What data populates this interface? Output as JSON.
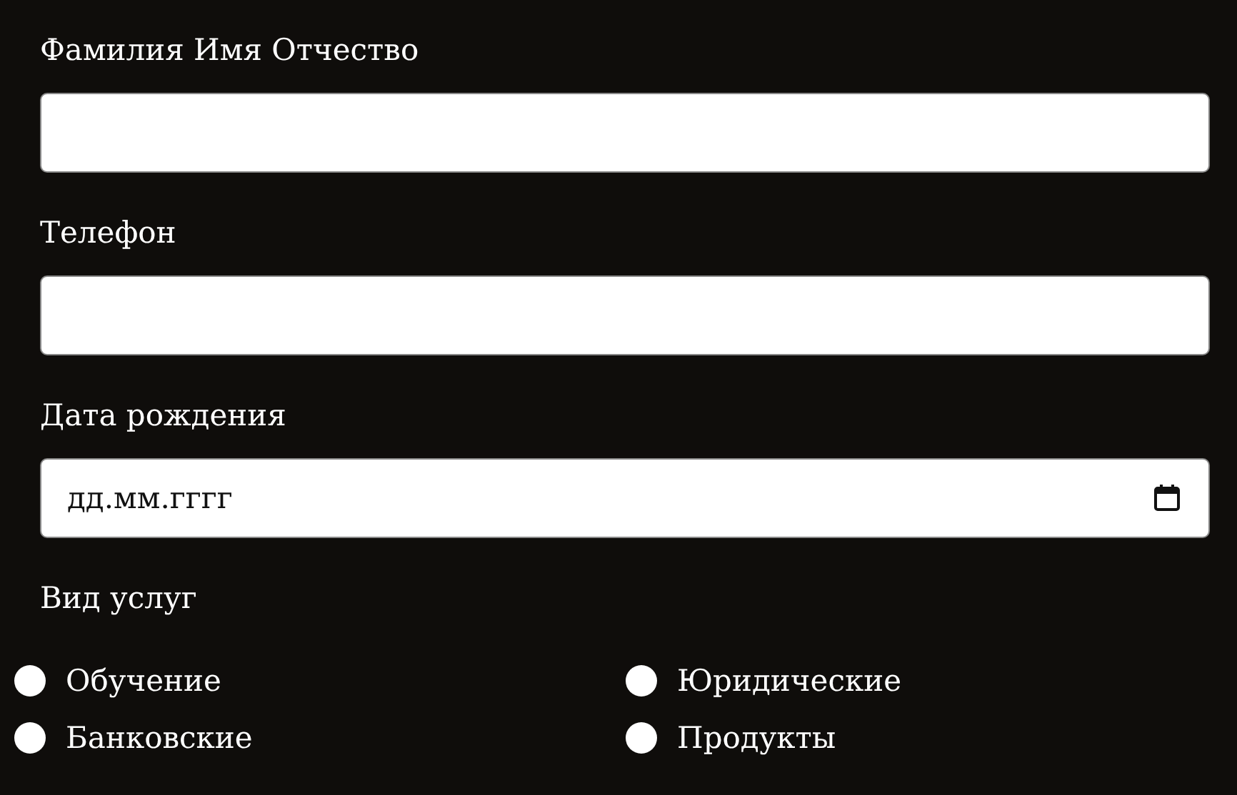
{
  "fields": [
    {
      "kind": "text",
      "label": "Фамилия Имя Отчество"
    },
    {
      "kind": "text",
      "label": "Телефон"
    },
    {
      "kind": "date",
      "label": "Дата рождения",
      "placeholder": "дд.мм.гггг"
    }
  ],
  "services": {
    "label": "Вид услуг",
    "options": [
      {
        "label": "Обучение",
        "selected": false
      },
      {
        "label": "Юридические",
        "selected": false
      },
      {
        "label": "Банковские",
        "selected": false
      },
      {
        "label": "Продукты",
        "selected": false
      }
    ]
  }
}
